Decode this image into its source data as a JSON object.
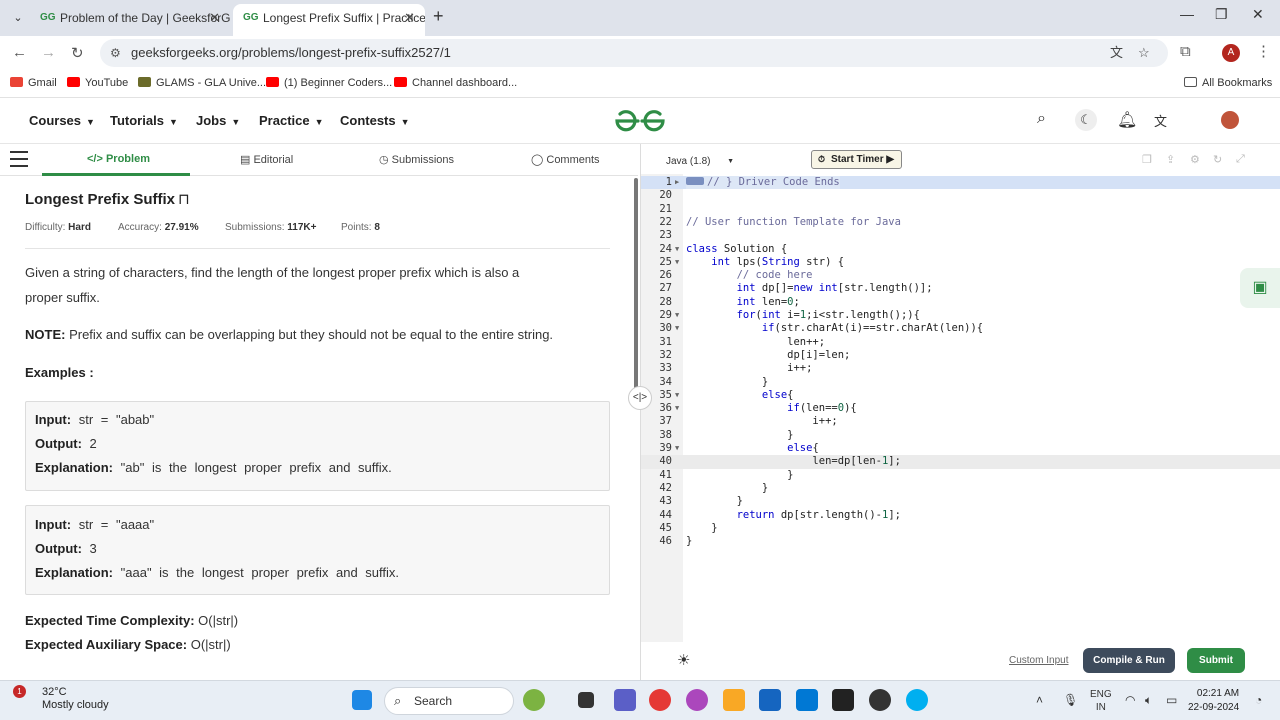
{
  "browser": {
    "tabs": [
      {
        "title": "Problem of the Day | GeeksforG",
        "active": false
      },
      {
        "title": "Longest Prefix Suffix | Practice |",
        "active": true
      }
    ],
    "url": "geeksforgeeks.org/problems/longest-prefix-suffix2527/1",
    "profile_initial": "A",
    "bookmarks": [
      "Gmail",
      "YouTube",
      "GLAMS - GLA Unive...",
      "(1) Beginner Coders...",
      "Channel dashboard..."
    ],
    "all_bookmarks": "All Bookmarks"
  },
  "site_nav": {
    "items": [
      "Courses",
      "Tutorials",
      "Jobs",
      "Practice",
      "Contests"
    ]
  },
  "problem_tabs": [
    "Problem",
    "Editorial",
    "Submissions",
    "Comments"
  ],
  "problem": {
    "title": "Longest Prefix Suffix",
    "difficulty_label": "Difficulty:",
    "difficulty": "Hard",
    "accuracy_label": "Accuracy:",
    "accuracy": "27.91%",
    "submissions_label": "Submissions:",
    "submissions": "117K+",
    "points_label": "Points:",
    "points": "8",
    "description_1": "Given a string of characters, find the length of the longest proper prefix which is also a",
    "description_2": "proper suffix.",
    "note_label": "NOTE:",
    "note": "Prefix and suffix can be overlapping but they should not be equal to the entire string.",
    "examples_heading": "Examples :",
    "examples": [
      {
        "input_label": "Input:",
        "input": "str = \"abab\"",
        "output_label": "Output:",
        "output": "2",
        "explanation_label": "Explanation:",
        "explanation": "\"ab\" is the longest proper prefix and suffix."
      },
      {
        "input_label": "Input:",
        "input": "str = \"aaaa\"",
        "output_label": "Output:",
        "output": "3",
        "explanation_label": "Explanation:",
        "explanation": "\"aaa\" is the longest proper prefix and suffix."
      }
    ],
    "time_label": "Expected Time Complexity:",
    "time": "O(|str|)",
    "space_label": "Expected Auxiliary Space:",
    "space": "O(|str|)"
  },
  "editor": {
    "language": "Java (1.8)",
    "timer_label": "Start Timer",
    "lines": [
      {
        "n": "1",
        "code": "// } Driver Code Ends",
        "type": "collapsed"
      },
      {
        "n": "20",
        "code": ""
      },
      {
        "n": "21",
        "code": ""
      },
      {
        "n": "22",
        "code": "// User function Template for Java",
        "type": "comment"
      },
      {
        "n": "23",
        "code": ""
      },
      {
        "n": "24",
        "code": "class Solution {",
        "fold": true
      },
      {
        "n": "25",
        "code": "    int lps(String str) {",
        "fold": true
      },
      {
        "n": "26",
        "code": "        // code here",
        "type": "comment"
      },
      {
        "n": "27",
        "code": "        int dp[]=new int[str.length()];"
      },
      {
        "n": "28",
        "code": "        int len=0;"
      },
      {
        "n": "29",
        "code": "        for(int i=1;i<str.length();){",
        "fold": true
      },
      {
        "n": "30",
        "code": "            if(str.charAt(i)==str.charAt(len)){",
        "fold": true
      },
      {
        "n": "31",
        "code": "                len++;"
      },
      {
        "n": "32",
        "code": "                dp[i]=len;"
      },
      {
        "n": "33",
        "code": "                i++;"
      },
      {
        "n": "34",
        "code": "            }"
      },
      {
        "n": "35",
        "code": "            else{",
        "fold": true
      },
      {
        "n": "36",
        "code": "                if(len==0){",
        "fold": true
      },
      {
        "n": "37",
        "code": "                    i++;"
      },
      {
        "n": "38",
        "code": "                }"
      },
      {
        "n": "39",
        "code": "                else{",
        "fold": true
      },
      {
        "n": "40",
        "code": "                    len=dp[len-1];",
        "type": "current"
      },
      {
        "n": "41",
        "code": "                }"
      },
      {
        "n": "42",
        "code": "            }"
      },
      {
        "n": "43",
        "code": "        }"
      },
      {
        "n": "44",
        "code": "        return dp[str.length()-1];"
      },
      {
        "n": "45",
        "code": "    }"
      },
      {
        "n": "46",
        "code": "}"
      }
    ],
    "custom_input": "Custom Input",
    "compile_run": "Compile & Run",
    "submit": "Submit"
  },
  "taskbar": {
    "weather_temp": "32°C",
    "weather_desc": "Mostly cloudy",
    "notification_count": "1",
    "search_placeholder": "Search",
    "lang_1": "ENG",
    "lang_2": "IN",
    "time": "02:21 AM",
    "date": "22-09-2024"
  },
  "colors": {
    "brand_green": "#2f8d46",
    "compile_button": "#3d4b5c",
    "submit_button": "#2f8d46"
  }
}
